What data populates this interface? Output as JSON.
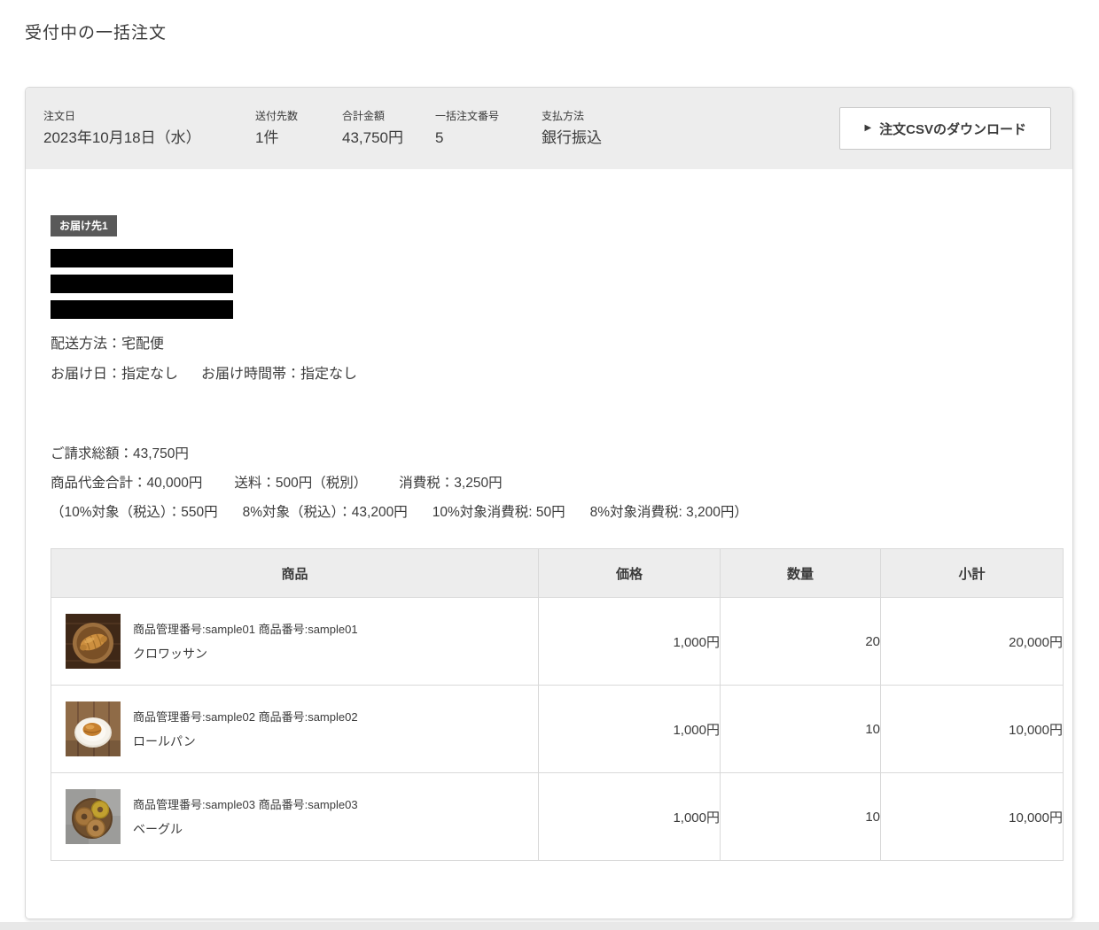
{
  "page_title": "受付中の一括注文",
  "summary": {
    "fields": [
      {
        "label": "注文日",
        "value": "2023年10月18日（水）"
      },
      {
        "label": "送付先数",
        "value": "1件"
      },
      {
        "label": "合計金額",
        "value": "43,750円"
      },
      {
        "label": "一括注文番号",
        "value": "5"
      },
      {
        "label": "支払方法",
        "value": "銀行振込"
      }
    ],
    "csv_button": {
      "icon": "▶",
      "label": "注文CSVのダウンロード"
    }
  },
  "destination": {
    "badge": "お届け先1",
    "redacted_lines": 3,
    "shipping_method": "配送方法：宅配便",
    "delivery_date": "お届け日：指定なし",
    "delivery_time": "お届け時間帯：指定なし"
  },
  "billing": {
    "total": "ご請求総額：43,750円",
    "item_total": "商品代金合計：40,000円",
    "shipping_fee": "送料：500円（税別）",
    "tax": "消費税：3,250円",
    "tax_10": "（10%対象（税込）：550円",
    "tax_8": "8%対象（税込）：43,200円",
    "tax_10_amount": "10%対象消費税: 50円",
    "tax_8_amount": "8%対象消費税: 3,200円）"
  },
  "table": {
    "headers": [
      "商品",
      "価格",
      "数量",
      "小計"
    ],
    "rows": [
      {
        "code": "商品管理番号:sample01 商品番号:sample01",
        "name": "クロワッサン",
        "price": "1,000円",
        "quantity": "20",
        "subtotal": "20,000円",
        "image": "croissant"
      },
      {
        "code": "商品管理番号:sample02 商品番号:sample02",
        "name": "ロールパン",
        "price": "1,000円",
        "quantity": "10",
        "subtotal": "10,000円",
        "image": "roll-bread"
      },
      {
        "code": "商品管理番号:sample03 商品番号:sample03",
        "name": "ベーグル",
        "price": "1,000円",
        "quantity": "10",
        "subtotal": "10,000円",
        "image": "bagel"
      }
    ]
  },
  "colors": {
    "header_bg": "#ededed",
    "badge_bg": "#595959",
    "border": "#d9d9d9",
    "text": "#3b3b3b",
    "redaction": "#000000",
    "button_bg": "#ffffff",
    "bottom_strip": "#e8e8e8"
  }
}
